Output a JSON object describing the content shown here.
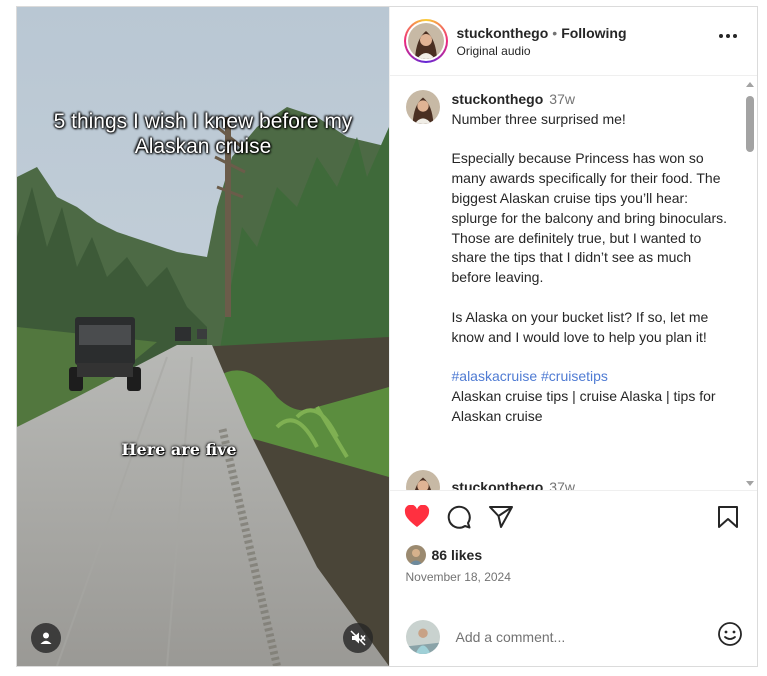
{
  "media": {
    "overlay_title": "5 things I wish I knew before my Alaskan cruise",
    "overlay_caption": "Here are five"
  },
  "header": {
    "username": "stuckonthego",
    "separator": "•",
    "follow_status": "Following",
    "audio": "Original audio"
  },
  "caption": {
    "username": "stuckonthego",
    "time": "37w",
    "paragraphs": [
      "Number three surprised me!",
      "Especially because Princess has won so many awards specifically for their food. The biggest Alaskan cruise tips you’ll hear: splurge for the balcony and bring binoculars. Those are definitely true, but I wanted to share the tips that I didn’t see as much before leaving.",
      "Is Alaska on your bucket list? If so, let me know and I would love to help you plan it!"
    ],
    "hashtags": "#alaskacruise #cruisetips",
    "tags_line": "Alaskan cruise tips | cruise Alaska | tips for Alaskan cruise"
  },
  "next_comment": {
    "username": "stuckonthego",
    "time": "37w"
  },
  "engagement": {
    "likes": "86 likes",
    "date": "November 18, 2024"
  },
  "comment_box": {
    "placeholder": "Add a comment..."
  },
  "colors": {
    "like_red": "#ff3040",
    "hashtag_blue": "#4f7bd3"
  },
  "icons": [
    "user-icon",
    "mute-icon",
    "more-icon",
    "heart-icon",
    "comment-icon",
    "share-icon",
    "save-icon",
    "emoji-icon"
  ]
}
